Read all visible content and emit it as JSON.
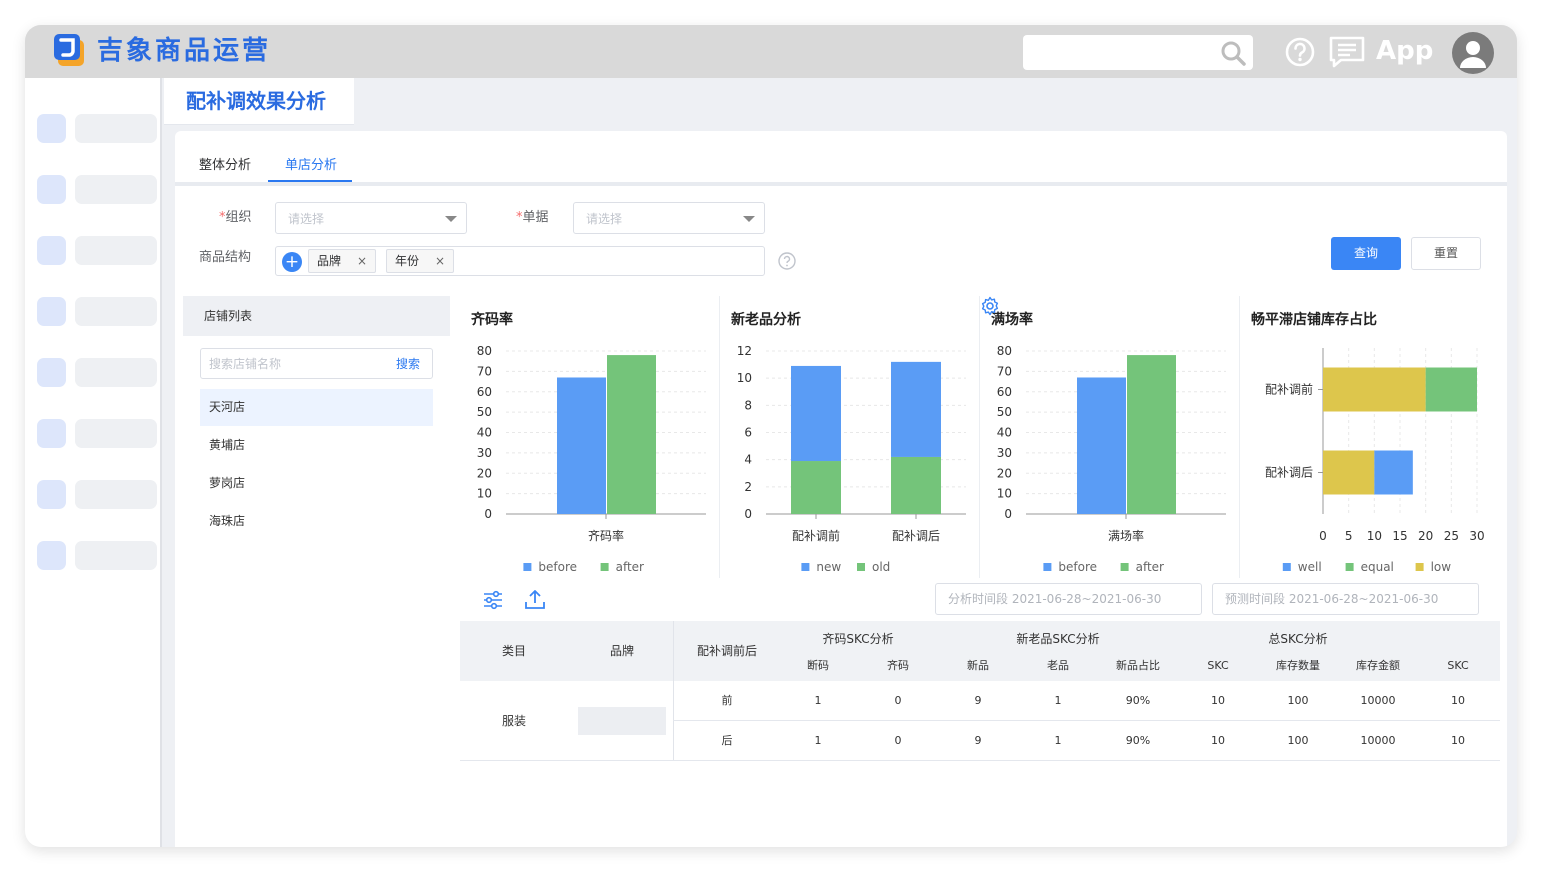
{
  "app": {
    "title": "吉象商品运营",
    "app_label": "App",
    "accent": "#2a6be0"
  },
  "page": {
    "title": "配补调效果分析"
  },
  "tabs": [
    {
      "label": "整体分析",
      "active": false
    },
    {
      "label": "单店分析",
      "active": true
    }
  ],
  "filters": {
    "org_label": "组织",
    "doc_label": "单据",
    "struct_label": "商品结构",
    "required_mark": "*",
    "org_placeholder": "请选择",
    "doc_placeholder": "请选择",
    "struct_tags": [
      "品牌",
      "年份"
    ],
    "query_label": "查询",
    "reset_label": "重置"
  },
  "store_panel": {
    "title": "店铺列表",
    "search_placeholder": "搜索店铺名称",
    "search_button": "搜索",
    "stores": [
      {
        "name": "天河店",
        "active": true
      },
      {
        "name": "黄埔店",
        "active": false
      },
      {
        "name": "萝岗店",
        "active": false
      },
      {
        "name": "海珠店",
        "active": false
      }
    ]
  },
  "chart_data": [
    {
      "type": "bar",
      "title": "齐码率",
      "categories": [
        "齐码率"
      ],
      "series": [
        {
          "name": "before",
          "color": "#5a9cf5",
          "values": [
            67
          ]
        },
        {
          "name": "after",
          "color": "#74c47a",
          "values": [
            78
          ]
        }
      ],
      "ylim": [
        0,
        80
      ],
      "yticks": [
        0,
        10,
        20,
        30,
        40,
        50,
        60,
        70,
        80
      ],
      "legend": "bottom"
    },
    {
      "type": "bar",
      "stacked": true,
      "title": "新老品分析",
      "categories": [
        "配补调前",
        "配补调后"
      ],
      "series": [
        {
          "name": "new",
          "color": "#5a9cf5",
          "values": [
            7,
            7
          ]
        },
        {
          "name": "old",
          "color": "#74c47a",
          "values": [
            3.9,
            4.2
          ]
        }
      ],
      "ylim": [
        0,
        12
      ],
      "yticks": [
        0,
        2,
        4,
        6,
        8,
        10,
        12
      ],
      "legend": "bottom"
    },
    {
      "type": "bar",
      "title": "满场率",
      "categories": [
        "满场率"
      ],
      "series": [
        {
          "name": "before",
          "color": "#5a9cf5",
          "values": [
            67
          ]
        },
        {
          "name": "after",
          "color": "#74c47a",
          "values": [
            78
          ]
        }
      ],
      "ylim": [
        0,
        80
      ],
      "yticks": [
        0,
        10,
        20,
        30,
        40,
        50,
        60,
        70,
        80
      ],
      "legend": "bottom"
    },
    {
      "type": "bar",
      "orientation": "horizontal",
      "stacked": true,
      "title": "畅平滞店铺库存占比",
      "categories": [
        "配补调前",
        "配补调后"
      ],
      "series": [
        {
          "name": "well",
          "color": "#5a9cf5",
          "values": [
            0,
            7.5
          ]
        },
        {
          "name": "equal",
          "color": "#74c47a",
          "values": [
            10,
            0
          ]
        },
        {
          "name": "low",
          "color": "#ddc64c",
          "values": [
            20,
            10
          ]
        }
      ],
      "stack_order": [
        "low",
        "equal",
        "well"
      ],
      "xlim": [
        0,
        30
      ],
      "xticks": [
        0,
        5,
        10,
        15,
        20,
        25,
        30
      ],
      "legend": "bottom"
    }
  ],
  "toolbar": {
    "analysis_range": "分析时间段   2021-06-28~2021-06-30",
    "forecast_range": "预测时间段   2021-06-28~2021-06-30"
  },
  "table": {
    "headers": {
      "category": "类目",
      "brand": "品牌",
      "phase": "配补调前后",
      "group1": "齐码SKC分析",
      "group2": "新老品SKC分析",
      "group3": "总SKC分析",
      "cols": [
        "断码",
        "齐码",
        "新品",
        "老品",
        "新品占比",
        "SKC",
        "库存数量",
        "库存金额",
        "SKC"
      ]
    },
    "category_value": "服装",
    "rows": [
      {
        "phase": "前",
        "cells": [
          "1",
          "0",
          "9",
          "1",
          "90%",
          "10",
          "100",
          "10000",
          "10"
        ]
      },
      {
        "phase": "后",
        "cells": [
          "1",
          "0",
          "9",
          "1",
          "90%",
          "10",
          "100",
          "10000",
          "10"
        ]
      }
    ]
  }
}
